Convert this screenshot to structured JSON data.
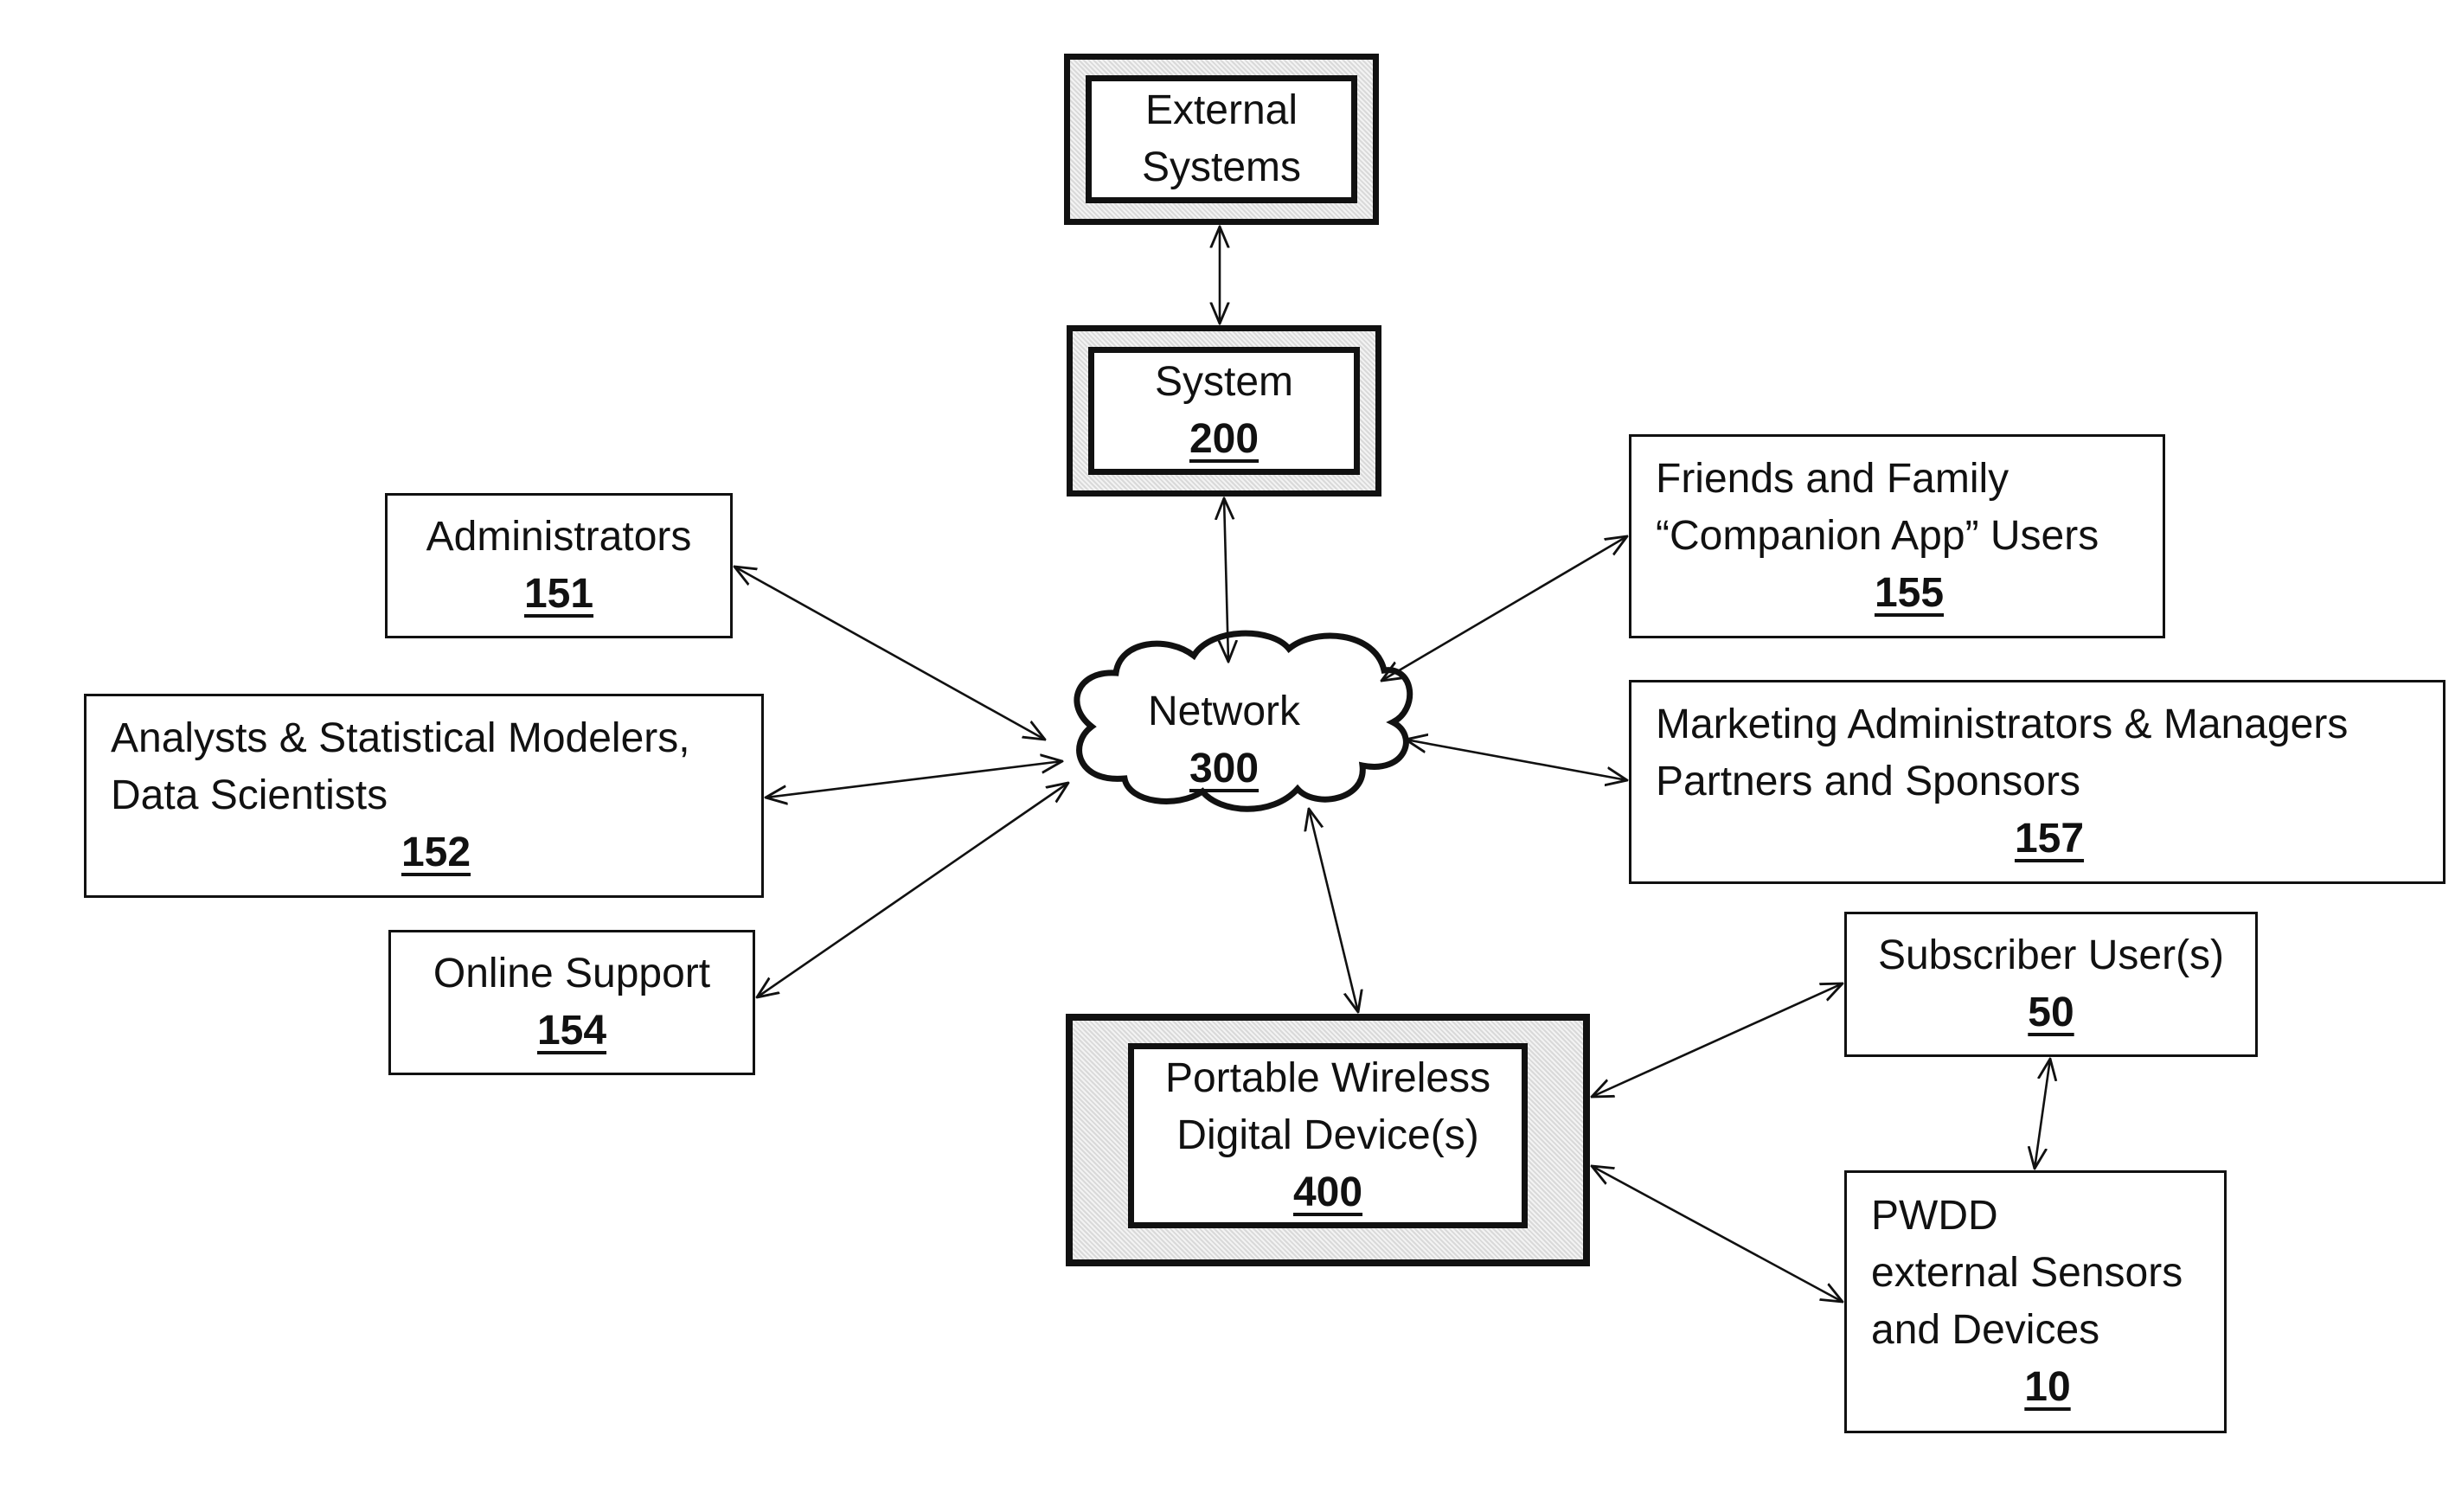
{
  "diagram": {
    "nodes": {
      "external_systems": {
        "lines": [
          "External",
          "Systems"
        ],
        "ref": ""
      },
      "system": {
        "lines": [
          "System"
        ],
        "ref": "200"
      },
      "network": {
        "lines": [
          "Network"
        ],
        "ref": "300"
      },
      "administrators": {
        "lines": [
          "Administrators"
        ],
        "ref": "151"
      },
      "analysts": {
        "lines": [
          "Analysts & Statistical Modelers,",
          "Data Scientists"
        ],
        "ref": "152"
      },
      "online_support": {
        "lines": [
          "Online Support"
        ],
        "ref": "154"
      },
      "friends_family": {
        "lines": [
          "Friends and Family",
          "“Companion App” Users"
        ],
        "ref": "155"
      },
      "marketing": {
        "lines": [
          "Marketing Administrators & Managers",
          "Partners and Sponsors"
        ],
        "ref": "157"
      },
      "pwdd": {
        "lines": [
          "Portable Wireless",
          "Digital Device(s)"
        ],
        "ref": "400"
      },
      "subscriber": {
        "lines": [
          "Subscriber User(s)"
        ],
        "ref": "50"
      },
      "sensors": {
        "lines": [
          "PWDD",
          "external Sensors",
          "and Devices"
        ],
        "ref": "10"
      }
    },
    "edges": [
      {
        "from": "external_systems",
        "to": "system",
        "bidirectional": true
      },
      {
        "from": "system",
        "to": "network",
        "bidirectional": true
      },
      {
        "from": "administrators",
        "to": "network",
        "bidirectional": true
      },
      {
        "from": "analysts",
        "to": "network",
        "bidirectional": true
      },
      {
        "from": "online_support",
        "to": "network",
        "bidirectional": true
      },
      {
        "from": "friends_family",
        "to": "network",
        "bidirectional": true
      },
      {
        "from": "marketing",
        "to": "network",
        "bidirectional": true
      },
      {
        "from": "network",
        "to": "pwdd",
        "bidirectional": true
      },
      {
        "from": "pwdd",
        "to": "subscriber",
        "bidirectional": true
      },
      {
        "from": "pwdd",
        "to": "sensors",
        "bidirectional": true
      },
      {
        "from": "subscriber",
        "to": "sensors",
        "bidirectional": true
      }
    ]
  }
}
